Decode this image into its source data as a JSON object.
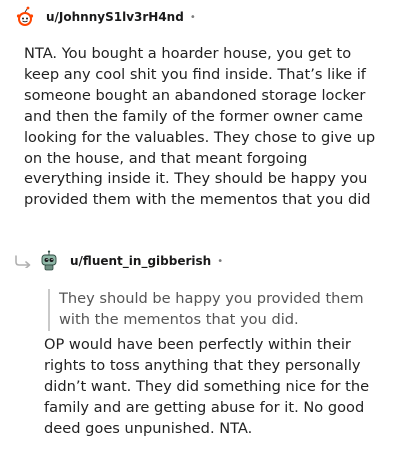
{
  "comment1": {
    "username": "u/JohnnyS1lv3rH4nd",
    "separator": "•",
    "body": "NTA. You bought a hoarder house, you get to keep any cool shit you find inside. That’s like if someone bought an abandoned storage locker and then the family of the former owner came looking for the valuables. They chose to give up on the house, and that meant forgoing everything inside it. They should be happy you provided them with the mementos that you did"
  },
  "comment2": {
    "username": "u/fluent_in_gibberish",
    "separator": "•",
    "quote": "They should be happy you provided them with the mementos that you did.",
    "body": "OP would have been perfectly within their rights to toss anything that they personally didn’t want. They did something nice for the family and are getting abuse for it. No good deed goes unpunished. NTA."
  },
  "colors": {
    "text": "#222222",
    "quote_text": "#555555",
    "quote_bar": "#c9c9c9",
    "meta": "#7c7c7c",
    "accent": "#ff4500"
  },
  "icons": {
    "avatar1": "snoo-avatar-icon",
    "avatar2": "robot-avatar-icon",
    "reply": "reply-arrow-icon"
  }
}
